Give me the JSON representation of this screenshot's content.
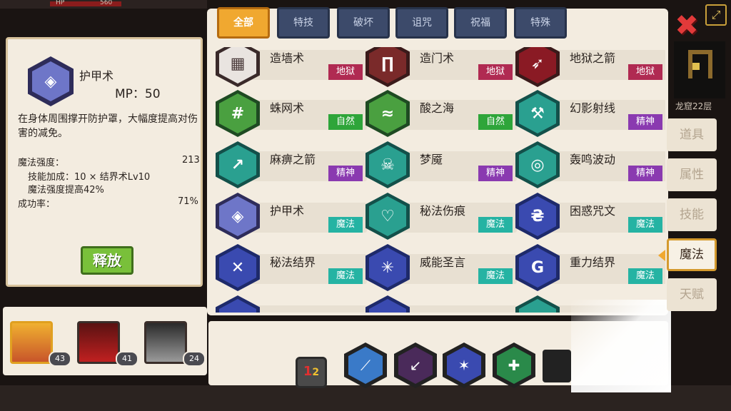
{
  "topbar": {
    "hp_label": "HP",
    "hp_value": "560"
  },
  "detail": {
    "skill_icon": "shield-rune-icon",
    "name": "护甲术",
    "mp": "MP：50",
    "description": "在身体周围撑开防护罩，大幅度提高对伤害的减免。",
    "stats": [
      {
        "label": "魔法强度：",
        "value": "213"
      },
      {
        "label": "技能加成：10 × 结界术Lv10",
        "value": ""
      },
      {
        "label": "魔法强度提高42%",
        "value": ""
      },
      {
        "label": "成功率：",
        "value": "71%"
      }
    ],
    "release_label": "释放"
  },
  "party": [
    {
      "icon": "golden-armor-hero-portrait",
      "level": "43"
    },
    {
      "icon": "red-dragon-portrait",
      "level": "41"
    },
    {
      "icon": "cat-girl-portrait",
      "level": "24"
    }
  ],
  "tabs": [
    {
      "label": "全部",
      "active": true
    },
    {
      "label": "特技",
      "active": false
    },
    {
      "label": "破坏",
      "active": false
    },
    {
      "label": "诅咒",
      "active": false
    },
    {
      "label": "祝福",
      "active": false
    },
    {
      "label": "特殊",
      "active": false
    }
  ],
  "skills": [
    {
      "name": "造墙术",
      "tag": "地狱",
      "icon": "wall-icon"
    },
    {
      "name": "造门术",
      "tag": "地狱",
      "icon": "gate-icon"
    },
    {
      "name": "地狱之箭",
      "tag": "地狱",
      "icon": "hell-arrow-icon"
    },
    {
      "name": "蛛网术",
      "tag": "自然",
      "icon": "web-icon"
    },
    {
      "name": "酸之海",
      "tag": "自然",
      "icon": "acid-sea-icon"
    },
    {
      "name": "幻影射线",
      "tag": "精神",
      "icon": "phantom-ray-icon"
    },
    {
      "name": "麻痹之箭",
      "tag": "精神",
      "icon": "paralysis-arrow-icon"
    },
    {
      "name": "梦魇",
      "tag": "精神",
      "icon": "nightmare-icon"
    },
    {
      "name": "轰鸣波动",
      "tag": "精神",
      "icon": "roar-wave-icon"
    },
    {
      "name": "护甲术",
      "tag": "魔法",
      "icon": "shield-rune-icon"
    },
    {
      "name": "秘法伤痕",
      "tag": "魔法",
      "icon": "heart-scar-icon"
    },
    {
      "name": "困惑咒文",
      "tag": "魔法",
      "icon": "confusion-rune-icon"
    },
    {
      "name": "秘法结界",
      "tag": "魔法",
      "icon": "arcane-barrier-icon"
    },
    {
      "name": "威能圣言",
      "tag": "魔法",
      "icon": "holy-word-icon"
    },
    {
      "name": "重力结界",
      "tag": "魔法",
      "icon": "gravity-barrier-icon"
    }
  ],
  "tag_colors": {
    "地狱": "#b02a52",
    "自然": "#2ea53a",
    "精神": "#8a3ab0",
    "魔法": "#25b3a3"
  },
  "tray": {
    "page_button": {
      "one": "1",
      "two": "2"
    },
    "icons": [
      "spear-thrust-icon",
      "dark-arrow-icon",
      "star-shards-icon",
      "heal-heart-icon"
    ]
  },
  "right": {
    "floor": "龙窟22层",
    "side_tabs": [
      {
        "label": "道具",
        "active": false
      },
      {
        "label": "属性",
        "active": false
      },
      {
        "label": "技能",
        "active": false
      },
      {
        "label": "魔法",
        "active": true
      },
      {
        "label": "天赋",
        "active": false
      }
    ]
  }
}
